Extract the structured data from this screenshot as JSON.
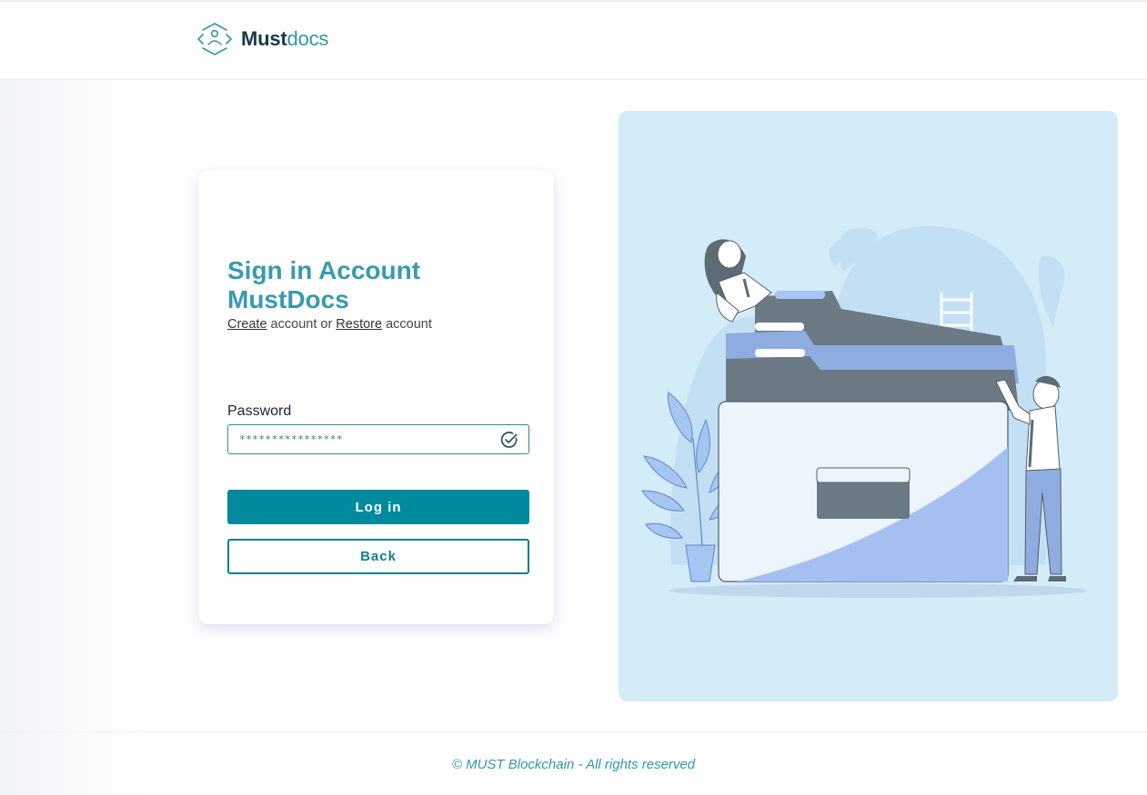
{
  "header": {
    "brand_part1": "Must",
    "brand_part2": "docs",
    "logo_icon": "hexagon-user-icon"
  },
  "login": {
    "title": "Sign in Account MustDocs",
    "create_link": "Create",
    "middle_text": " account or ",
    "restore_link": "Restore",
    "end_text": " account",
    "password_label": "Password",
    "password_value": "****************",
    "valid_icon": "check-circle-icon",
    "login_button": "Log in",
    "back_button": "Back"
  },
  "illustration": {
    "description_icon": "documents-folder-illustration"
  },
  "footer": {
    "copyright": "© MUST Blockchain - All rights reserved"
  },
  "colors": {
    "brand_dark": "#163a46",
    "brand_accent": "#2f97a8",
    "primary_button": "#008a9e",
    "illustration_bg": "#d4ebf8"
  }
}
